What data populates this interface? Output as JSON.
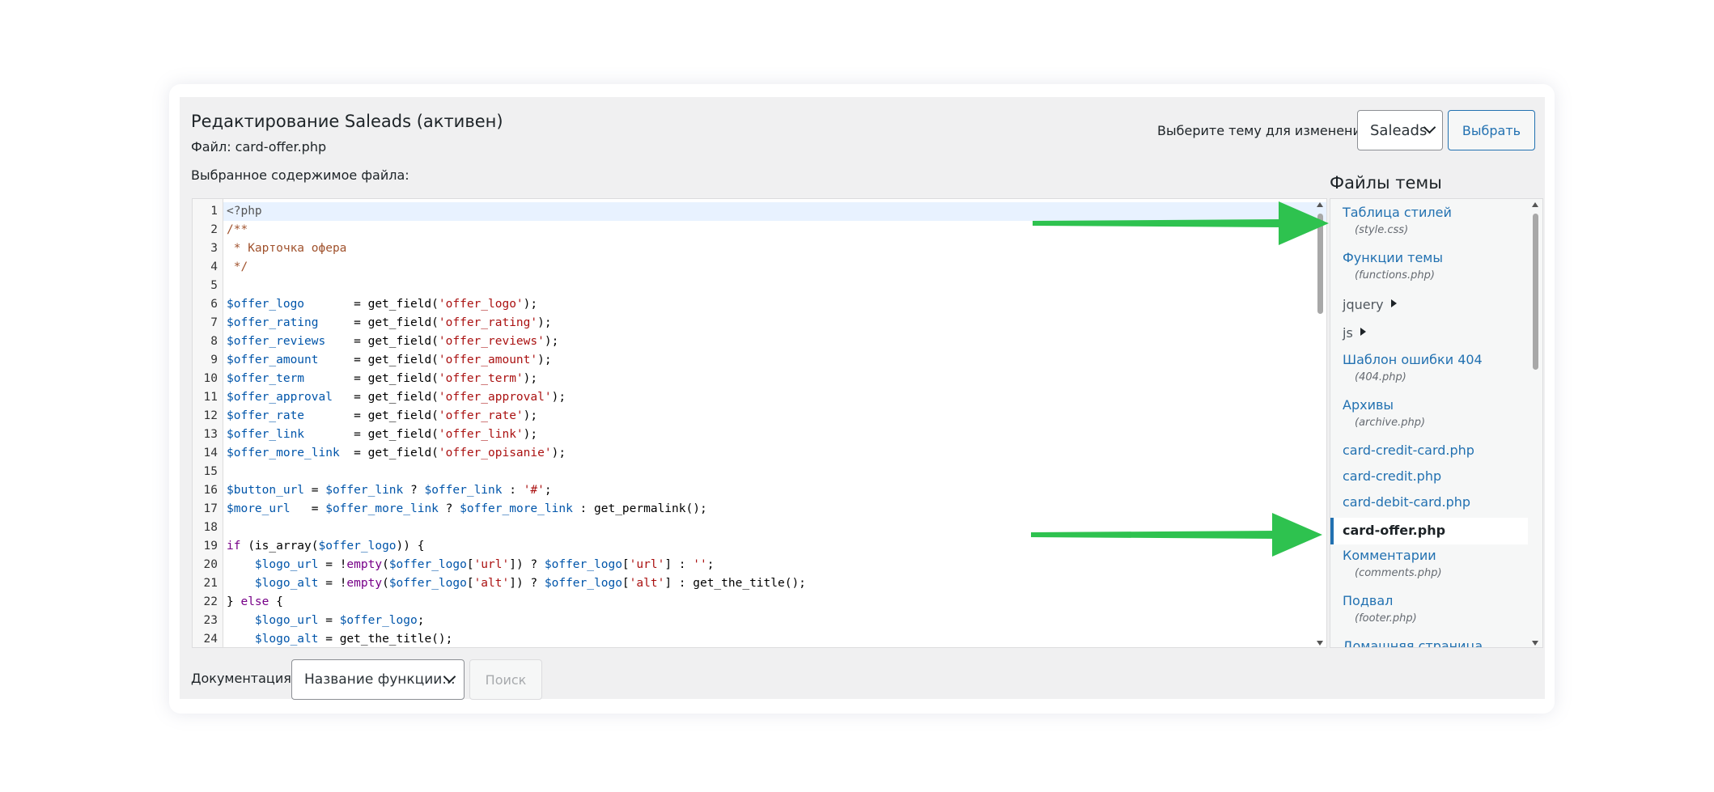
{
  "header": {
    "title": "Редактирование Saleads (активен)",
    "file_label": "Файл: card-offer.php",
    "content_label": "Выбранное содержимое файла:"
  },
  "theme_picker": {
    "label": "Выберите тему для изменения:",
    "selected": "Saleads",
    "button": "Выбрать"
  },
  "editor": {
    "lines": [
      {
        "n": "1",
        "html": "<span class=\"c-meta\">&lt;?php</span>"
      },
      {
        "n": "2",
        "html": "<span class=\"c-cmt\">/**</span>"
      },
      {
        "n": "3",
        "html": "<span class=\"c-cmt\"> * Карточка офера</span>"
      },
      {
        "n": "4",
        "html": "<span class=\"c-cmt\"> */</span>"
      },
      {
        "n": "5",
        "html": ""
      },
      {
        "n": "6",
        "html": "<span class=\"c-var\">$offer_logo</span>       = get_field(<span class=\"c-str\">'offer_logo'</span>);"
      },
      {
        "n": "7",
        "html": "<span class=\"c-var\">$offer_rating</span>     = get_field(<span class=\"c-str\">'offer_rating'</span>);"
      },
      {
        "n": "8",
        "html": "<span class=\"c-var\">$offer_reviews</span>    = get_field(<span class=\"c-str\">'offer_reviews'</span>);"
      },
      {
        "n": "9",
        "html": "<span class=\"c-var\">$offer_amount</span>     = get_field(<span class=\"c-str\">'offer_amount'</span>);"
      },
      {
        "n": "10",
        "html": "<span class=\"c-var\">$offer_term</span>       = get_field(<span class=\"c-str\">'offer_term'</span>);"
      },
      {
        "n": "11",
        "html": "<span class=\"c-var\">$offer_approval</span>   = get_field(<span class=\"c-str\">'offer_approval'</span>);"
      },
      {
        "n": "12",
        "html": "<span class=\"c-var\">$offer_rate</span>       = get_field(<span class=\"c-str\">'offer_rate'</span>);"
      },
      {
        "n": "13",
        "html": "<span class=\"c-var\">$offer_link</span>       = get_field(<span class=\"c-str\">'offer_link'</span>);"
      },
      {
        "n": "14",
        "html": "<span class=\"c-var\">$offer_more_link</span>  = get_field(<span class=\"c-str\">'offer_opisanie'</span>);"
      },
      {
        "n": "15",
        "html": ""
      },
      {
        "n": "16",
        "html": "<span class=\"c-var\">$button_url</span> = <span class=\"c-var\">$offer_link</span> ? <span class=\"c-var\">$offer_link</span> : <span class=\"c-str\">'#'</span>;"
      },
      {
        "n": "17",
        "html": "<span class=\"c-var\">$more_url</span>   = <span class=\"c-var\">$offer_more_link</span> ? <span class=\"c-var\">$offer_more_link</span> : get_permalink();"
      },
      {
        "n": "18",
        "html": ""
      },
      {
        "n": "19",
        "html": "<span class=\"c-kw\">if</span> (is_array(<span class=\"c-var\">$offer_logo</span>)) {"
      },
      {
        "n": "20",
        "html": "    <span class=\"c-var\">$logo_url</span> = !<span class=\"c-kw\">empty</span>(<span class=\"c-var\">$offer_logo</span>[<span class=\"c-str\">'url'</span>]) ? <span class=\"c-var\">$offer_logo</span>[<span class=\"c-str\">'url'</span>] : <span class=\"c-str\">''</span>;"
      },
      {
        "n": "21",
        "html": "    <span class=\"c-var\">$logo_alt</span> = !<span class=\"c-kw\">empty</span>(<span class=\"c-var\">$offer_logo</span>[<span class=\"c-str\">'alt'</span>]) ? <span class=\"c-var\">$offer_logo</span>[<span class=\"c-str\">'alt'</span>] : get_the_title();"
      },
      {
        "n": "22",
        "html": "} <span class=\"c-kw\">else</span> {"
      },
      {
        "n": "23",
        "html": "    <span class=\"c-var\">$logo_url</span> = <span class=\"c-var\">$offer_logo</span>;"
      },
      {
        "n": "24",
        "html": "    <span class=\"c-var\">$logo_alt</span> = get_the_title();"
      }
    ]
  },
  "files": {
    "heading": "Файлы темы",
    "items": [
      {
        "name": "Таблица стилей",
        "sub": "(style.css)"
      },
      {
        "name": "Функции темы",
        "sub": "(functions.php)"
      },
      {
        "name": "jquery",
        "folder": true
      },
      {
        "name": "js",
        "folder": true
      },
      {
        "name": "Шаблон ошибки 404",
        "sub": "(404.php)"
      },
      {
        "name": "Архивы",
        "sub": "(archive.php)"
      },
      {
        "name": "card-credit-card.php"
      },
      {
        "name": "card-credit.php"
      },
      {
        "name": "card-debit-card.php"
      },
      {
        "name": "card-offer.php",
        "active": true
      },
      {
        "name": "Комментарии",
        "sub": "(comments.php)"
      },
      {
        "name": "Подвал",
        "sub": "(footer.php)"
      },
      {
        "name": "Домашняя страница"
      }
    ]
  },
  "docs": {
    "label": "Документация:",
    "selected": "Название функции...",
    "button": "Поиск"
  },
  "colors": {
    "accent": "#2271b1",
    "annotation_arrow": "#2ec24f"
  }
}
